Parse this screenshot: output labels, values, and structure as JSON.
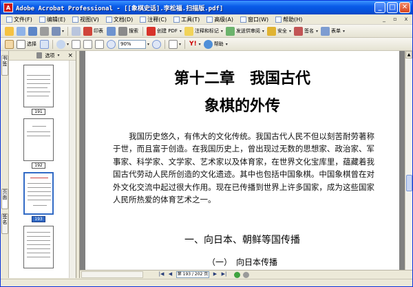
{
  "window": {
    "title": "Adobe Acrobat Professional - [[象棋史话].李松福.扫描版.pdf]",
    "min_label": "_",
    "max_label": "□",
    "close_label": "✕"
  },
  "menubar": {
    "items": [
      "文件(F)",
      "编辑(E)",
      "视图(V)",
      "文档(D)",
      "注释(C)",
      "工具(T)",
      "高级(A)",
      "窗口(W)",
      "帮助(H)"
    ]
  },
  "toolbar1": {
    "items": [
      {
        "label": "创建 PDF",
        "icon": "create-pdf-icon"
      },
      {
        "label": "注释和标记",
        "icon": "comment-icon"
      },
      {
        "label": "发送供审阅",
        "icon": "send-review-icon"
      },
      {
        "label": "安全",
        "icon": "lock-icon"
      },
      {
        "label": "签名",
        "icon": "pen-icon"
      },
      {
        "label": "表单",
        "icon": "form-icon"
      }
    ],
    "print_label": "印表",
    "search_label": "搜索"
  },
  "toolbar2": {
    "select_label": "选择",
    "zoom_value": "90%",
    "help_label": "帮助",
    "yahoo_label": "Y!"
  },
  "navtabs": {
    "bookmarks": "书签",
    "pages": "页面",
    "signatures": "签名"
  },
  "thumbpanel": {
    "options_label": "选项",
    "close_label": "×",
    "thumbs": [
      {
        "label": "191",
        "selected": false
      },
      {
        "label": "192",
        "selected": false
      },
      {
        "label": "193",
        "selected": true
      },
      {
        "label": "",
        "selected": false
      }
    ]
  },
  "document": {
    "chapter_line1": "第十二章　我国古代",
    "chapter_line2": "象棋的外传",
    "paragraph": "我国历史悠久，有伟大的文化传统。我国古代人民不但以刻苦耐劳著称于世，而且富于创造。在我国历史上，曾出现过无数的思想家、政治家、军事家、科学家、文学家、艺术家以及体育家，在世界文化宝库里，蕴藏着我国古代劳动人民所创造的文化遗迹。其中也包括中国象棋。中国象棋曾在对外文化交流中起过很大作用。现在已传播到世界上许多国家，成为这些国家人民所热爱的体育艺术之一。",
    "section_title": "一、向日本、朝鲜等国传播",
    "sub_title": "（一）　向日本传播"
  },
  "statusbar": {
    "page_indicator": "第 193 / 202 页"
  },
  "colors": {
    "titlebar": "#0a5ce9",
    "selection": "#316ac5",
    "chrome": "#ece9d8",
    "doc_background": "#808080"
  }
}
